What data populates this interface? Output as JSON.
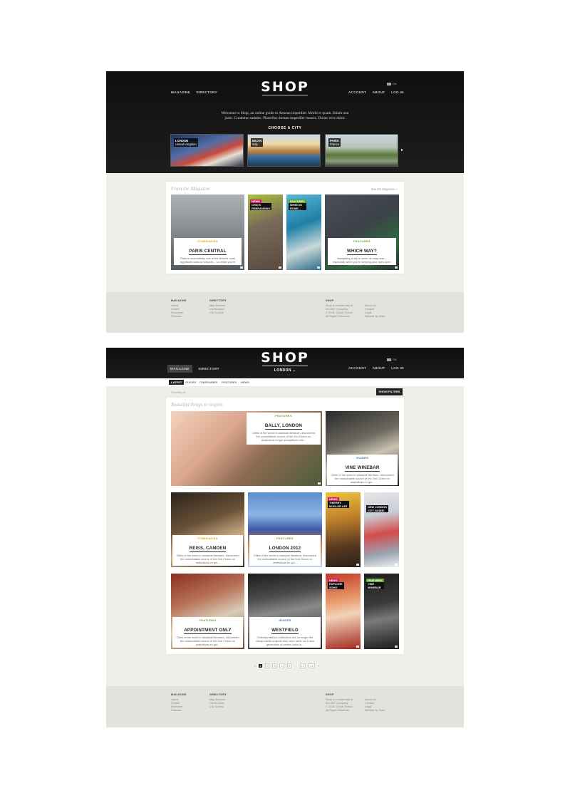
{
  "page1": {
    "nav_left": [
      "MAGAZINE",
      "DIRECTORY"
    ],
    "logo": "SHOP",
    "nav_right": [
      "ACCOUNT",
      "ABOUT",
      "LOG IN"
    ],
    "lang": "EN",
    "welcome_line1": "Welcome to Shop, an online guide to Aenean imperdiet. Morbi et quam. Etiam non",
    "welcome_line2": "justo. Curabitur sodales. Phasellus dictum imperdiet mauris. Donec eros dolor.",
    "choose_city": "CHOOSE A CITY",
    "cities": [
      {
        "name": "LONDON",
        "country": "United Kingdom"
      },
      {
        "name": "MILAN",
        "country": "Italy"
      },
      {
        "name": "PARIS",
        "country": "France"
      }
    ],
    "magazine_title": "From the Magazine",
    "see_magazine": "See the Magazine",
    "tiles": [
      {
        "category": "ITINERARIES",
        "title": "PARIS CENTRAL",
        "desc": "Paris is undoubtedly one of the World's most significant cultural hotspots – so whilst you're there, make sure you visit..."
      },
      {
        "badge": "NEWS",
        "headline1": "CHIC'S",
        "headline2": "REBRANDING"
      },
      {
        "badge": "FEATURES",
        "headline1": "WHEN IN",
        "headline2": "ROME..."
      },
      {
        "category": "FEATURES",
        "title": "WHICH WAY?",
        "desc": "Navigating a city is never an easy task – especially when you're keeping your eyes open for bargains! So when..."
      }
    ]
  },
  "footer": {
    "col1": {
      "heading": "MAGAZINE",
      "items": [
        "Latest",
        "Guides",
        "Itineraries",
        "Features"
      ]
    },
    "col2": {
      "heading": "DIRECTORY",
      "items": [
        "Map Browser",
        "List Browser",
        "City Guides"
      ]
    },
    "col3": {
      "heading": "SHOP",
      "items": [
        "Shop is a trademark of",
        "the ABC Company",
        "© 2010, Global School",
        "All Rights Reserved"
      ]
    },
    "col4": {
      "items": [
        "About Us",
        "Contact",
        "Legal",
        "Website by Slant"
      ]
    }
  },
  "page2": {
    "nav_left": [
      "MAGAZINE",
      "DIRECTORY"
    ],
    "logo": "SHOP",
    "city_label": "LONDON",
    "nav_right": [
      "ACCOUNT",
      "ABOUT",
      "LOG IN"
    ],
    "lang": "EN",
    "filters": [
      "LATEST",
      "GUIDES",
      "ITINERARIES",
      "FEATURES",
      "NEWS"
    ],
    "showing": "Showing all",
    "show_filters": "SHOW FILTERS",
    "section_title": "Beautiful things to inspire.",
    "tiles": [
      {
        "category": "FEATURES",
        "title": "BALLY, LONDON",
        "desc": "Cities of the world in classical literature, discovered the undoubtable source of the 2nd Cicero on anabolicas en gui suscipitlorim bin..."
      },
      {
        "category": "GUIDES",
        "title": "VINE WINEBAR",
        "desc": "Cities of the world in classical literature, discovered the undoubtable source of the 2nd Cicero on anabolicas en gui..."
      },
      {
        "category": "ITINERARIES",
        "title": "REISS, CAMDEN",
        "desc": "Cities of the world in classical literature, discovered the undoubtable source of the 2nd Cicero on anabolicas en gui..."
      },
      {
        "category": "FEATURES",
        "title": "LONDON 2012",
        "desc": "Cities of the world in classical literature, discovered the undoubtable source of the 2nd Cicero on anabolicas en gui..."
      },
      {
        "badge": "NEWS",
        "headline1": "THIERRY",
        "headline2": "MUGLER ART"
      },
      {
        "headline1": "NEW LONDON",
        "headline2": "CITY GUIDE!"
      },
      {
        "category": "FEATURES",
        "title": "APPOINTMENT ONLY",
        "desc": "Cities of the world in classical literature, discovered the undoubtable source of the 2nd Cicero on anabolicas en gui..."
      },
      {
        "category": "GUIDES",
        "title": "WESTFIELD",
        "desc": "Celebrity fashion collections are no longer the cheap vanity projects they once were, as a new generation of celebs looks to..."
      },
      {
        "badge": "NEWS",
        "headline1": "EXPLORE",
        "headline2": "SOHO"
      },
      {
        "badge": "FEATURES",
        "headline1": "VINE",
        "headline2": "WINEBAR"
      }
    ],
    "pager": {
      "prev": "«",
      "pages": [
        "1",
        "2",
        "3",
        "4",
        "5",
        "...",
        "12",
        "13"
      ],
      "next": "»",
      "current": "1"
    }
  },
  "colors": {
    "topbar": "#151515",
    "page_bg": "#efeee9",
    "footer_bg": "#e3e2dc",
    "news": "#d4195e",
    "features": "#5ba52c",
    "guides": "#2e76c1",
    "itineraries": "#e5a100"
  }
}
